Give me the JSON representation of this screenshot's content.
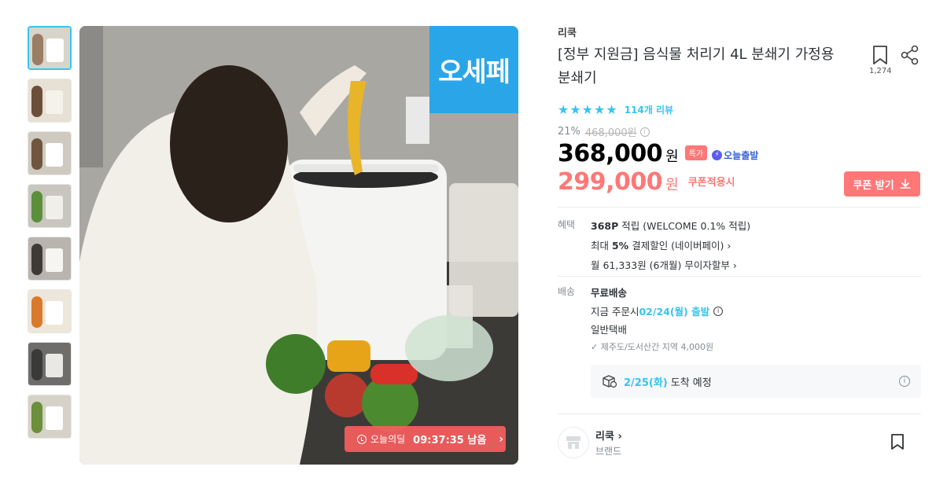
{
  "thumbnails": [
    {
      "label": "thumb-1",
      "colors": [
        "#d8d4cc",
        "#ffffff",
        "#9a7d63"
      ]
    },
    {
      "label": "thumb-2",
      "colors": [
        "#e7e0d4",
        "#f5f2ec",
        "#6b4f3a"
      ]
    },
    {
      "label": "thumb-3",
      "colors": [
        "#cfcac0",
        "#ffffff",
        "#70553f"
      ]
    },
    {
      "label": "thumb-4",
      "colors": [
        "#c9c6c0",
        "#f1efea",
        "#5c8f3a"
      ]
    },
    {
      "label": "thumb-5",
      "colors": [
        "#b9b4ad",
        "#f7f5f1",
        "#3f3a35"
      ]
    },
    {
      "label": "thumb-6",
      "colors": [
        "#ede6da",
        "#ffffff",
        "#d9792b"
      ]
    },
    {
      "label": "thumb-7",
      "colors": [
        "#6e6d6b",
        "#e9e8e4",
        "#3a3a38"
      ]
    },
    {
      "label": "thumb-8",
      "colors": [
        "#d7d2c7",
        "#ffffff",
        "#6c8f3a"
      ]
    }
  ],
  "main_image": {
    "badge_text": "오세페",
    "timer_label": "오늘의딜",
    "timer_time": "09:37:35 남음",
    "timer_chevron": "›"
  },
  "product": {
    "brand": "리쿡",
    "title": "[정부 지원금] 음식물 처리기 4L 분쇄기 가정용 분쇄기",
    "scrap_count": "1,274",
    "rating_stars": 5,
    "review_text": "114개 리뷰",
    "discount_rate": "21%",
    "original_price": "468,000원",
    "price": "368,000",
    "price_unit": "원",
    "tag_sale": "특가",
    "tag_today": "오늘출발",
    "coupon_price": "299,000",
    "coupon_unit": "원",
    "coupon_note": "쿠폰적용시",
    "coupon_button": "쿠폰 받기"
  },
  "benefits": {
    "label": "혜택",
    "line1_bold": "368P",
    "line1_rest": " 적립 (WELCOME 0.1% 적립)",
    "line2_pre": "최대 ",
    "line2_bold": "5%",
    "line2_rest": " 결제할인 (네이버페이) ›",
    "line3": "월 61,333원 (6개월) 무이자할부 ›"
  },
  "delivery": {
    "label": "배송",
    "free": "무료배송",
    "order_pre": "지금 주문시 ",
    "order_date": "02/24(월) 출발",
    "type": "일반택배",
    "extra": "✓ 제주도/도서산간 지역 4,000원",
    "arrival_date": "2/25(화)",
    "arrival_rest": "도착 예정"
  },
  "store": {
    "name": "리쿡 ›",
    "sub": "브랜드"
  }
}
